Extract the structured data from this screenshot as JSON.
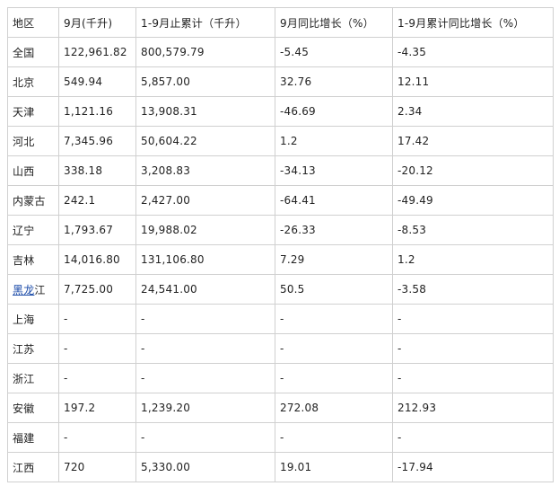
{
  "table": {
    "headers": [
      "地区",
      "9月(千升)",
      "1-9月止累计（千升）",
      "9月同比增长（%）",
      "1-9月累计同比增长（%）"
    ],
    "rows": [
      {
        "region": "全国",
        "sep": "122,961.82",
        "ytd": "800,579.79",
        "sep_yoy": "-5.45",
        "ytd_yoy": "-4.35"
      },
      {
        "region": "北京",
        "sep": "549.94",
        "ytd": "5,857.00",
        "sep_yoy": "32.76",
        "ytd_yoy": "12.11"
      },
      {
        "region": "天津",
        "sep": "1,121.16",
        "ytd": "13,908.31",
        "sep_yoy": "-46.69",
        "ytd_yoy": "2.34"
      },
      {
        "region": "河北",
        "sep": "7,345.96",
        "ytd": "50,604.22",
        "sep_yoy": "1.2",
        "ytd_yoy": "17.42"
      },
      {
        "region": "山西",
        "sep": "338.18",
        "ytd": "3,208.83",
        "sep_yoy": "-34.13",
        "ytd_yoy": "-20.12"
      },
      {
        "region": "内蒙古",
        "sep": "242.1",
        "ytd": "2,427.00",
        "sep_yoy": "-64.41",
        "ytd_yoy": "-49.49"
      },
      {
        "region": "辽宁",
        "sep": "1,793.67",
        "ytd": "19,988.02",
        "sep_yoy": "-26.33",
        "ytd_yoy": "-8.53"
      },
      {
        "region": "吉林",
        "sep": "14,016.80",
        "ytd": "131,106.80",
        "sep_yoy": "7.29",
        "ytd_yoy": "1.2"
      },
      {
        "region": "黑龙江",
        "region_link": "黑龙",
        "region_rest": "江",
        "sep": "7,725.00",
        "ytd": "24,541.00",
        "sep_yoy": "50.5",
        "ytd_yoy": "-3.58"
      },
      {
        "region": "上海",
        "sep": "-",
        "ytd": "-",
        "sep_yoy": "-",
        "ytd_yoy": "-"
      },
      {
        "region": "江苏",
        "sep": "-",
        "ytd": "-",
        "sep_yoy": "-",
        "ytd_yoy": "-"
      },
      {
        "region": "浙江",
        "sep": "-",
        "ytd": "-",
        "sep_yoy": "-",
        "ytd_yoy": "-"
      },
      {
        "region": "安徽",
        "sep": "197.2",
        "ytd": "1,239.20",
        "sep_yoy": "272.08",
        "ytd_yoy": "212.93"
      },
      {
        "region": "福建",
        "sep": "-",
        "ytd": "-",
        "sep_yoy": "-",
        "ytd_yoy": "-"
      },
      {
        "region": "江西",
        "sep": "720",
        "ytd": "5,330.00",
        "sep_yoy": "19.01",
        "ytd_yoy": "-17.94"
      }
    ]
  }
}
